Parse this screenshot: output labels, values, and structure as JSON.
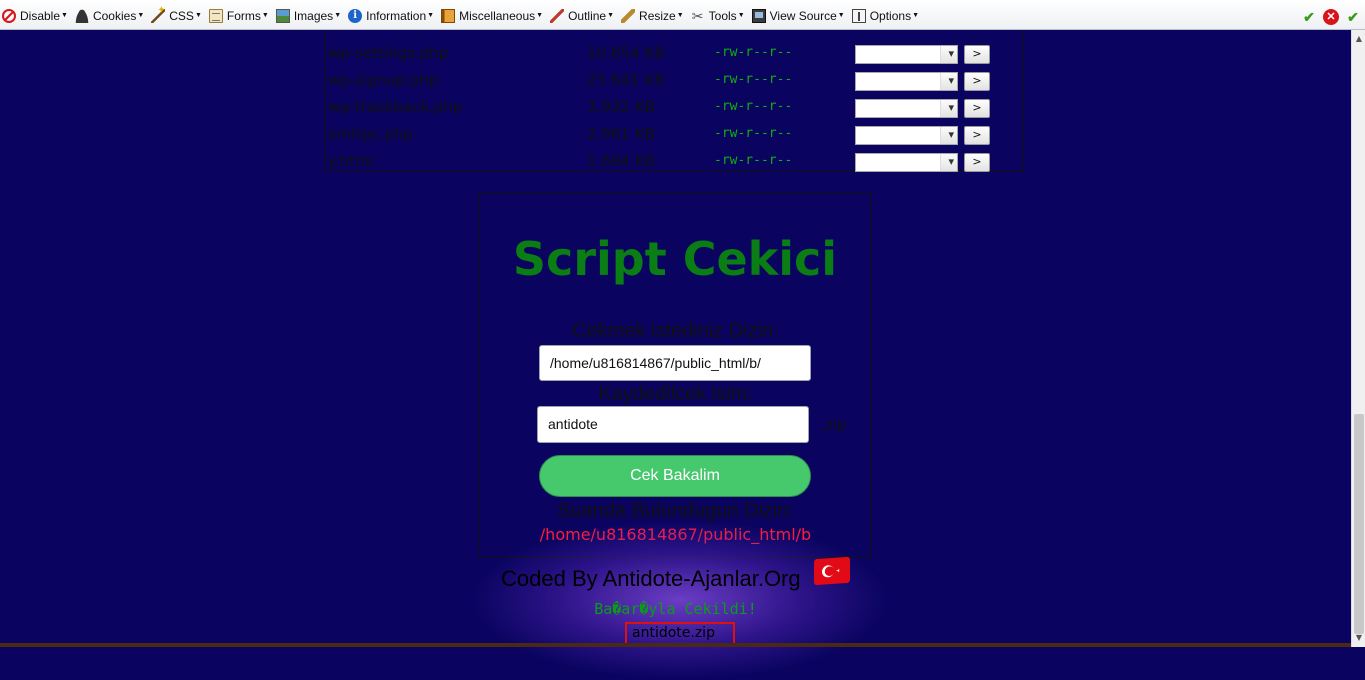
{
  "toolbar": {
    "items": [
      {
        "label": "Disable",
        "icon": "disable-icon"
      },
      {
        "label": "Cookies",
        "icon": "user-icon"
      },
      {
        "label": "CSS",
        "icon": "wand-icon"
      },
      {
        "label": "Forms",
        "icon": "form-icon"
      },
      {
        "label": "Images",
        "icon": "image-icon"
      },
      {
        "label": "Information",
        "icon": "info-icon"
      },
      {
        "label": "Miscellaneous",
        "icon": "misc-icon"
      },
      {
        "label": "Outline",
        "icon": "pencil-icon"
      },
      {
        "label": "Resize",
        "icon": "resize-icon"
      },
      {
        "label": "Tools",
        "icon": "tools-icon"
      },
      {
        "label": "View Source",
        "icon": "source-icon"
      },
      {
        "label": "Options",
        "icon": "options-icon"
      }
    ]
  },
  "files": [
    {
      "name": "wp-settings.php",
      "size": "10.854 KB",
      "perm": "-rw-r--r--"
    },
    {
      "name": "wp-signup.php",
      "size": "25.641 KB",
      "perm": "-rw-r--r--"
    },
    {
      "name": "wp-trackback.php",
      "size": "3.932 KB",
      "perm": "-rw-r--r--"
    },
    {
      "name": "xmlrpc.php",
      "size": "2.961 KB",
      "perm": "-rw-r--r--"
    },
    {
      "name": "y.html",
      "size": "1.694 KB",
      "perm": "-rw-r--r--"
    }
  ],
  "file_action_label": ">",
  "panel": {
    "title": "Script Cekici",
    "dir_label": "Cekmek istediniz Dizin:",
    "dir_value": "/home/u816814867/public_html/b/",
    "name_label": "Kaydedilcek isim:",
    "name_value": "antidote",
    "ext": ".zip",
    "button": "Cek Bakalim",
    "current_label": "Suanda Bulundugun Dizin:",
    "current_path": "/home/u816814867/public_html/b"
  },
  "footer": {
    "coded": "Coded By Antidote-Ajanlar.Org",
    "success": "Ba�ar�yla Cekildi!",
    "file": "antidote.zip"
  },
  "colors": {
    "background": "#0a0460",
    "title": "#0a7d14",
    "button": "#46c86c",
    "path": "#ff1d3a",
    "perm": "#10b010"
  }
}
